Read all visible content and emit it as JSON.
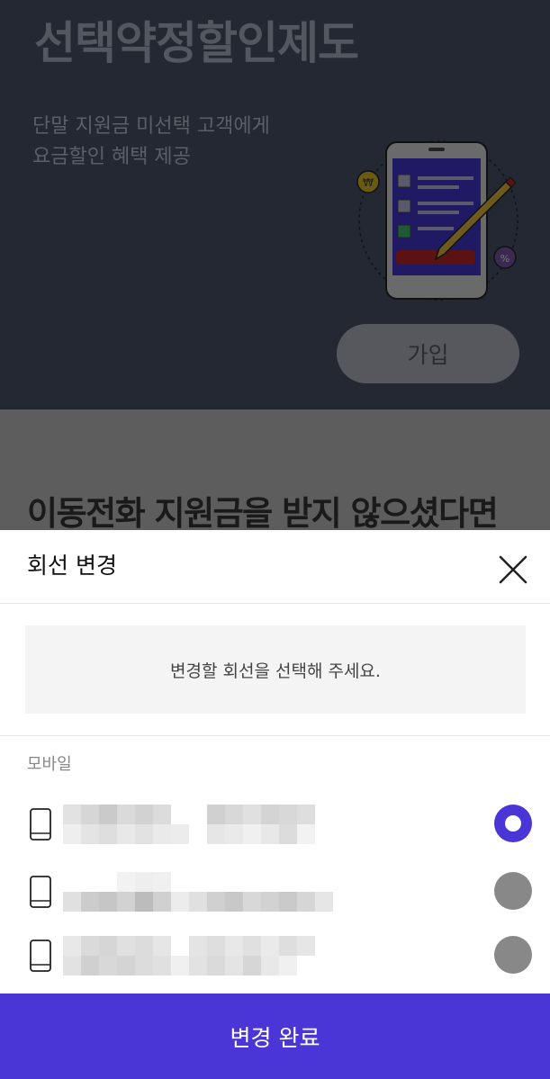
{
  "background": {
    "title": "선택약정할인제도",
    "description_line1": "단말 지원금 미선택 고객에게",
    "description_line2": "요금할인 혜택 제공",
    "join_label": "가입",
    "section_heading": "이동전화 지원금을 받지 않으셨다면",
    "illustration": {
      "coin_icon_label": "₩",
      "percent_icon_label": "%"
    }
  },
  "sheet": {
    "title": "회선 변경",
    "close_icon": "close-icon",
    "notice": "변경할 회선을 선택해 주세요.",
    "section_label": "모바일",
    "lines": [
      {
        "icon": "mobile-phone-icon",
        "selected": true
      },
      {
        "icon": "mobile-phone-icon",
        "selected": false
      },
      {
        "icon": "mobile-phone-icon",
        "selected": false
      }
    ],
    "confirm_label": "변경 완료"
  },
  "colors": {
    "accent": "#4a35d6",
    "radio_off": "#888888",
    "overlay_dark": "#232833"
  }
}
